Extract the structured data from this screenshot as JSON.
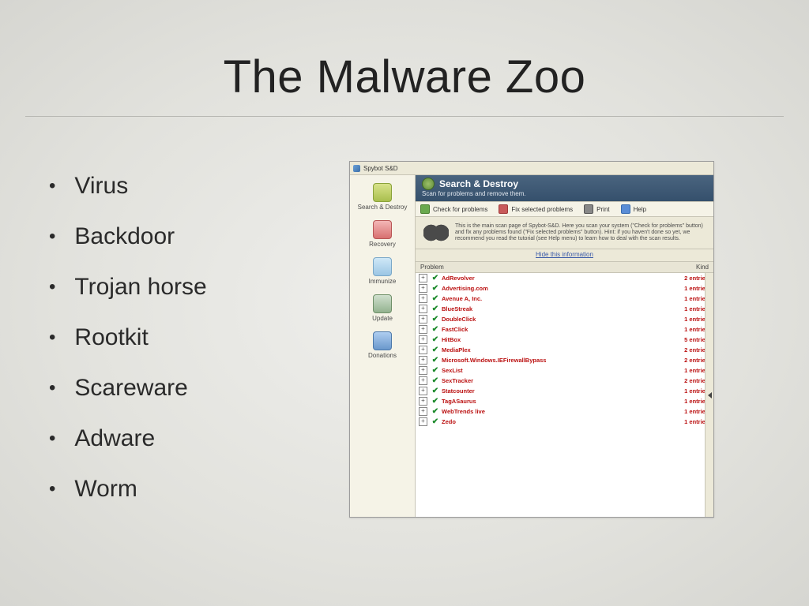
{
  "title": "The Malware Zoo",
  "bullets": [
    "Virus",
    "Backdoor",
    "Trojan horse",
    "Rootkit",
    "Scareware",
    "Adware",
    "Worm"
  ],
  "app": {
    "window_title": "Spybot S&D",
    "sidebar": {
      "search": "Search & Destroy",
      "recovery": "Recovery",
      "immunize": "Immunize",
      "update": "Update",
      "donations": "Donations"
    },
    "panel": {
      "title": "Search & Destroy",
      "sub": "Scan for problems and remove them."
    },
    "toolbar": {
      "check": "Check for problems",
      "fix": "Fix selected problems",
      "print": "Print",
      "help": "Help"
    },
    "intro": "This is the main scan page of Spybot-S&D. Here you scan your system (\"Check for problems\" button) and fix any problems found (\"Fix selected problems\" button). Hint: if you haven't done so yet, we recommend you read the tutorial (see Help menu) to learn how to deal with the scan results.",
    "hide_link": "Hide this information",
    "columns": {
      "problem": "Problem",
      "kind": "Kind"
    },
    "results": [
      {
        "name": "AdRevolver",
        "count": 2
      },
      {
        "name": "Advertising.com",
        "count": 1
      },
      {
        "name": "Avenue A, Inc.",
        "count": 1
      },
      {
        "name": "BlueStreak",
        "count": 1
      },
      {
        "name": "DoubleClick",
        "count": 1
      },
      {
        "name": "FastClick",
        "count": 1
      },
      {
        "name": "HitBox",
        "count": 5
      },
      {
        "name": "MediaPlex",
        "count": 2
      },
      {
        "name": "Microsoft.Windows.IEFirewallBypass",
        "count": 2
      },
      {
        "name": "SexList",
        "count": 1
      },
      {
        "name": "SexTracker",
        "count": 2
      },
      {
        "name": "Statcounter",
        "count": 1
      },
      {
        "name": "TagASaurus",
        "count": 1
      },
      {
        "name": "WebTrends live",
        "count": 1
      },
      {
        "name": "Zedo",
        "count": 1
      }
    ],
    "entries_word": "entries"
  }
}
